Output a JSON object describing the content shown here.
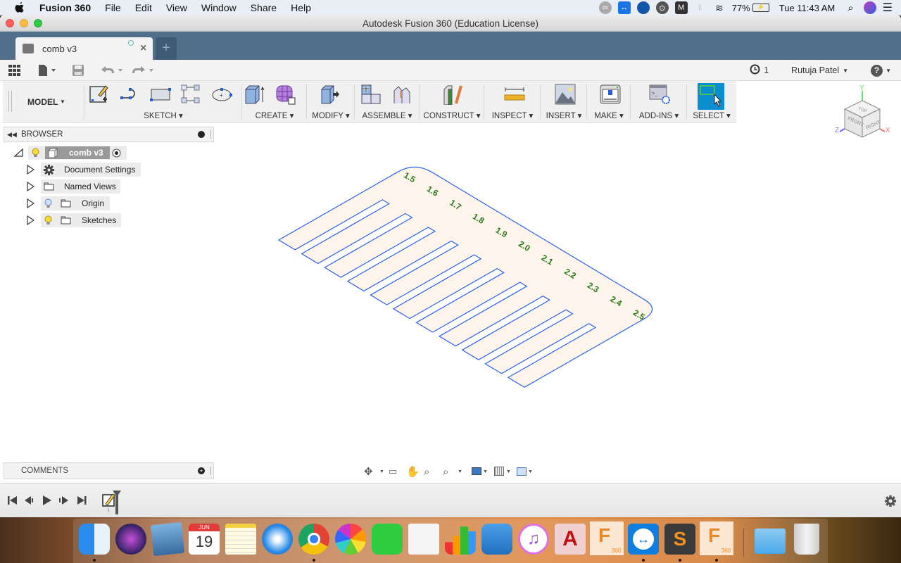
{
  "menubar": {
    "app_name": "Fusion 360",
    "items": [
      "File",
      "Edit",
      "View",
      "Window",
      "Share",
      "Help"
    ],
    "battery": "77%",
    "clock": "Tue 11:43 AM",
    "status_icons": [
      "creative-cloud-icon",
      "teamviewer-icon",
      "drive-icon",
      "eye-icon",
      "malwarebytes-icon",
      "bluetooth-icon",
      "wifi-icon",
      "battery-icon",
      "spotlight-icon",
      "siri-icon",
      "notification-center-icon"
    ]
  },
  "window": {
    "title": "Autodesk Fusion 360 (Education License)"
  },
  "tabs": {
    "active": "comb v3",
    "new_tab": "+"
  },
  "quick_access": {
    "job_count": "1",
    "user": "Rutuja Patel",
    "help": "?"
  },
  "toolbar": {
    "workspace": "MODEL",
    "groups": [
      "SKETCH",
      "CREATE",
      "MODIFY",
      "ASSEMBLE",
      "CONSTRUCT",
      "INSPECT",
      "INSERT",
      "MAKE",
      "ADD-INS",
      "SELECT"
    ]
  },
  "viewcube": {
    "faces": [
      "TOP",
      "FRONT",
      "RIGHT"
    ],
    "axes": [
      "Y",
      "Z",
      "X"
    ],
    "colors": {
      "x": "#e06060",
      "y": "#60d060",
      "z": "#6060e0"
    }
  },
  "browser": {
    "title": "BROWSER",
    "root": "comb v3",
    "items": [
      {
        "label": "Document Settings",
        "icon": "gear-icon",
        "visible_bulb": false
      },
      {
        "label": "Named Views",
        "icon": "folder-icon",
        "visible_bulb": false
      },
      {
        "label": "Origin",
        "icon": "folder-icon",
        "visible_bulb": true,
        "bulb_state": "off"
      },
      {
        "label": "Sketches",
        "icon": "folder-icon",
        "visible_bulb": true,
        "bulb_state": "on"
      }
    ]
  },
  "canvas": {
    "comb_labels": [
      "1.5",
      "1.6",
      "1.7",
      "1.8",
      "1.9",
      "2.0",
      "2.1",
      "2.2",
      "2.3",
      "2.4",
      "2.5"
    ],
    "outline_color": "#2a62e8",
    "fill_color": "#fdf5ec",
    "text_color": "#2d7a1a"
  },
  "comments": {
    "title": "COMMENTS"
  },
  "dock": {
    "apps": [
      "Finder",
      "Siri",
      "Mail",
      "Calendar",
      "Notes",
      "Safari",
      "Chrome",
      "Photos",
      "FaceTime",
      "Pages",
      "Numbers",
      "Keynote",
      "iTunes",
      "AutoCAD",
      "Fusion 360",
      "TeamViewer",
      "Sublime Text",
      "Fusion 360",
      "Downloads",
      "Trash"
    ],
    "calendar_month": "JUN",
    "calendar_day": "19",
    "fusion_badge": "360"
  }
}
